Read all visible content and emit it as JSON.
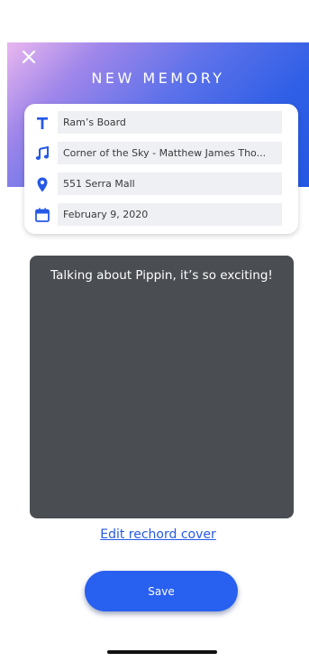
{
  "header": {
    "title": "NEW MEMORY",
    "close_icon": "close-icon",
    "gradient_colors": [
      "#e9b7ef",
      "#9f86ea",
      "#5c71ea",
      "#2457e3"
    ]
  },
  "info_card": {
    "title_field": {
      "icon": "text-t-icon",
      "value": "Ram’s Board"
    },
    "song_field": {
      "icon": "music-note-icon",
      "value": "Corner of the Sky - Matthew James Tho..."
    },
    "location_field": {
      "icon": "location-pin-icon",
      "value": "551 Serra Mall"
    },
    "date_field": {
      "icon": "calendar-icon",
      "value": "February 9, 2020"
    },
    "icon_color": "#2659e6"
  },
  "memory": {
    "text": "Talking about Pippin, it’s so exciting!",
    "box_color": "#4a4d52"
  },
  "edit_cover_label": "Edit rechord cover",
  "save_label": "Save",
  "accent_color": "#2860f0"
}
